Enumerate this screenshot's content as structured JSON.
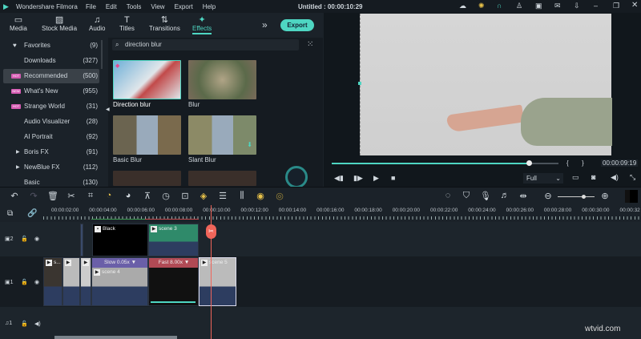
{
  "app": {
    "title": "Wondershare Filmora",
    "project": "Untitled : 00:00:10:29",
    "menu": [
      "File",
      "Edit",
      "Tools",
      "View",
      "Export",
      "Help"
    ]
  },
  "tabs": [
    {
      "label": "Media",
      "icon": "folder-icon"
    },
    {
      "label": "Stock Media",
      "icon": "image-icon"
    },
    {
      "label": "Audio",
      "icon": "music-icon"
    },
    {
      "label": "Titles",
      "icon": "text-icon"
    },
    {
      "label": "Transitions",
      "icon": "transition-icon"
    },
    {
      "label": "Effects",
      "icon": "effects-icon",
      "active": true
    }
  ],
  "export_label": "Export",
  "categories": [
    {
      "label": "Favorites",
      "count": "(9)"
    },
    {
      "label": "Downloads",
      "count": "(327)"
    },
    {
      "label": "Recommended",
      "count": "(500)",
      "badge": "HOT",
      "selected": true
    },
    {
      "label": "What's New",
      "count": "(955)",
      "badge": "NEW"
    },
    {
      "label": "Strange World",
      "count": "(31)",
      "badge": "HOT"
    },
    {
      "label": "Audio Visualizer",
      "count": "(28)"
    },
    {
      "label": "AI Portrait",
      "count": "(92)"
    },
    {
      "label": "Boris FX",
      "count": "(91)"
    },
    {
      "label": "NewBlue FX",
      "count": "(112)"
    },
    {
      "label": "Basic",
      "count": "(130)"
    }
  ],
  "search": {
    "value": "direction blur"
  },
  "effects": [
    {
      "label": "Direction blur"
    },
    {
      "label": "Blur"
    },
    {
      "label": "Basic Blur"
    },
    {
      "label": "Slant Blur"
    }
  ],
  "player": {
    "time": "00:00:09:19",
    "progress": 0.87,
    "quality": "Full",
    "bracket_in": "{",
    "bracket_out": "}"
  },
  "ruler": [
    "00:00:02:00",
    "00:00:04:00",
    "00:00:06:00",
    "00:00:08:00",
    "00:00:10:00",
    "00:00:12:00",
    "00:00:14:00",
    "00:00:16:00",
    "00:00:18:00",
    "00:00:20:00",
    "00:00:22:00",
    "00:00:24:00",
    "00:00:26:00",
    "00:00:28:00",
    "00:00:30:00",
    "00:00:32"
  ],
  "tracks": {
    "v2": "2",
    "v1": "1",
    "a1": "1"
  },
  "clips": {
    "black": "Black",
    "scene3": "scene 3",
    "s": "s...",
    "slow": "Slow 0.05x ▼",
    "scene4": "scene 4",
    "fast": "Fast 8.00x ▼",
    "scene5": "scene 5"
  },
  "watermark": "wtvid.com",
  "colors": {
    "accent": "#4ed6c2",
    "playhead": "#f0655a"
  }
}
